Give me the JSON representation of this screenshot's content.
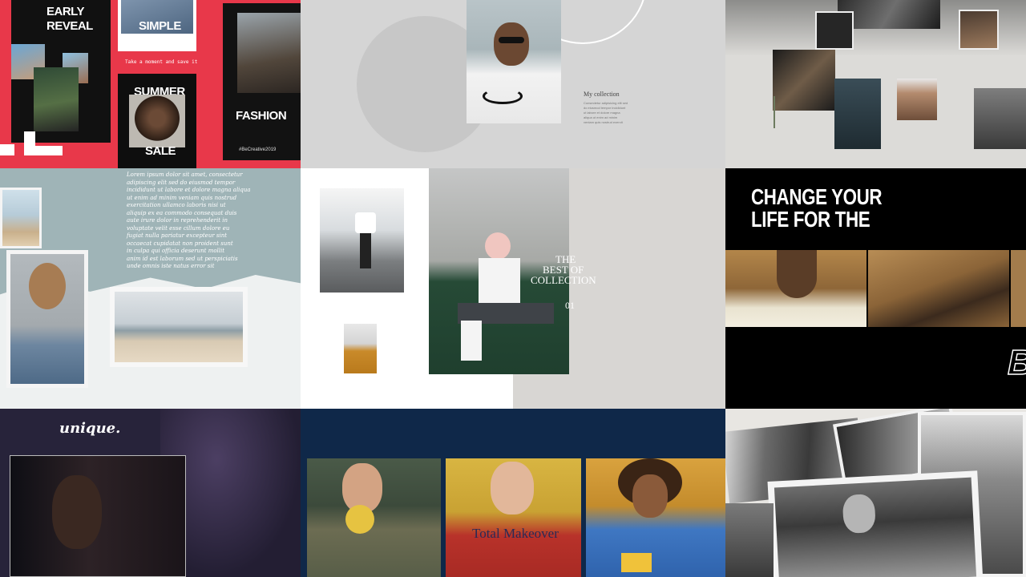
{
  "panel_red": {
    "early_reveal_line1": "EARLY",
    "early_reveal_line2": "REVEAL",
    "simple": "SIMPLE",
    "summer": "SUMMER",
    "sale": "SALE",
    "fashion": "FASHION",
    "tagline": "Take a moment and save it",
    "handle": "#BeCreative2019"
  },
  "panel_collection": {
    "heading": "My collection",
    "body_lines": [
      "Consectetur adipisicing elit sed",
      "do eiusmod tempor incididunt",
      "ut labore et dolore magna",
      "aliqua ut enim ad minim",
      "veniam quis nostrud exercit"
    ]
  },
  "panel_letter": {
    "lines": [
      "Lorem ipsum dolor sit amet, consectetur",
      "adipiscing elit sed do eiusmod tempor",
      "incididunt ut labore et dolore magna aliqua",
      "ut enim ad minim veniam quis nostrud",
      "exercitation ullamco laboris nisi ut",
      "aliquip ex ea commodo consequat duis",
      "aute irure dolor in reprehenderit in",
      "voluptate velit esse cillum dolore eu",
      "fugiat nulla pariatur excepteur sint",
      "occaecat cupidatat non proident sunt",
      "in culpa qui officia deserunt mollit",
      "anim id est laborum sed ut perspiciatis",
      "unde omnis iste natus error sit"
    ]
  },
  "panel_bestof": {
    "line1": "THE",
    "line2": "BEST OF",
    "line3": "COLLECTION",
    "number": "01"
  },
  "panel_change": {
    "line1": "CHANGE YOUR",
    "line2": "LIFE FOR THE",
    "corner_letter": "B"
  },
  "panel_unique": {
    "word": "unique."
  },
  "panel_makeover": {
    "title": "Total Makeover"
  },
  "colors": {
    "red": "#e8384a",
    "navy": "#0f2849",
    "grey": "#d5d5d5",
    "purple": "#27233a"
  }
}
